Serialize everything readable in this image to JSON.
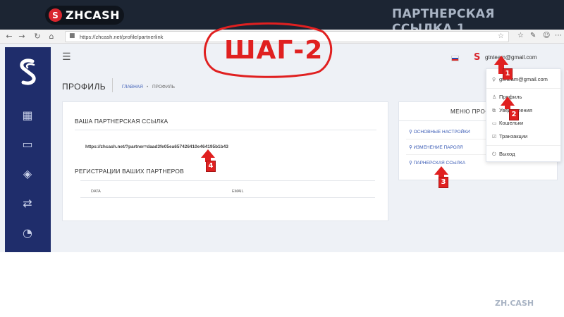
{
  "slide": {
    "logo_mark": "S",
    "logo_text": "ZHCASH",
    "title": "ПАРТНЕРСКАЯ ССЫЛКА 1",
    "step_label": "ШАГ-2",
    "footer_brand": "ZH.CASH"
  },
  "browser": {
    "back_icon": "←",
    "forward_icon": "→",
    "reload_icon": "↻",
    "home_icon": "⌂",
    "lock_icon": "🔒",
    "url": "https://zhcash.net/profile/partnerlink",
    "star_icon": "☆"
  },
  "app": {
    "user_email": "gtnteam@gmail.com",
    "hamburger_icon": "☰",
    "page_title": "ПРОФИЛЬ",
    "breadcrumb": {
      "home": "ГЛАВНАЯ",
      "separator": "•",
      "current": "ПРОФИЛЬ"
    },
    "partner_card": {
      "title": "ВАША ПАРТНЕРСКАЯ ССЫЛКА",
      "link": "https://zhcash.net/?partner=daad3fe05ea657426410e464195b1b43",
      "registrations_title": "РЕГИСТРАЦИИ ВАШИХ ПАРТНЕРОВ",
      "columns": [
        "DATA",
        "EMAIL"
      ]
    },
    "profile_menu": {
      "title": "МЕНЮ ПРОФИЛЯ",
      "items": [
        "ОСНОВНЫЕ НАСТРОЙКИ",
        "ИЗМЕНЕНИЕ ПАРОЛЯ",
        "ПАРНЕРСКАЯ ССЫЛКА"
      ]
    },
    "user_dropdown": {
      "email": "gtnteam@gmail.com",
      "items": [
        "Профиль",
        "Уведомления",
        "Кошельки",
        "Транзакции"
      ],
      "logout": "Выход"
    },
    "sidebar_icons": [
      "logo-icon",
      "dashboard-icon",
      "wallet-icon",
      "layers-icon",
      "shuffle-icon",
      "gauge-icon"
    ]
  },
  "annotations": {
    "badges": [
      "1",
      "2",
      "3",
      "4"
    ],
    "color": "#e02020"
  }
}
